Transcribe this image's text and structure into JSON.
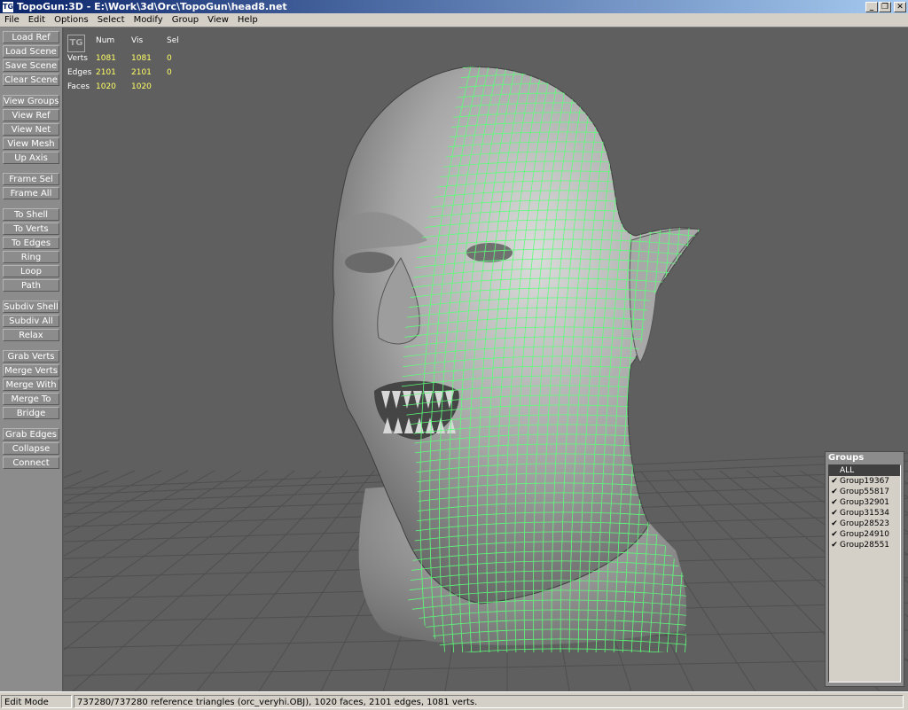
{
  "window": {
    "title": "TopoGun:3D - E:\\Work\\3d\\Orc\\TopoGun\\head8.net",
    "app_icon": "TG",
    "controls": {
      "minimize": "_",
      "restore": "❐",
      "close": "✕"
    }
  },
  "menu": [
    "File",
    "Edit",
    "Options",
    "Select",
    "Modify",
    "Group",
    "View",
    "Help"
  ],
  "toolbar": {
    "buttons": [
      "Load Ref",
      "Load Scene",
      "Save Scene",
      "Clear Scene",
      "View Groups",
      "View Ref",
      "View Net",
      "View Mesh",
      "Up Axis",
      "Frame Sel",
      "Frame All",
      "To Shell",
      "To Verts",
      "To Edges",
      "Ring",
      "Loop",
      "Path",
      "Subdiv Shell",
      "Subdiv All",
      "Relax",
      "Grab Verts",
      "Merge Verts",
      "Merge With",
      "Merge To",
      "Bridge",
      "Grab Edges",
      "Collapse",
      "Connect"
    ]
  },
  "stats": {
    "headers": {
      "num": "Num",
      "vis": "Vis",
      "sel": "Sel"
    },
    "rows": [
      {
        "label": "Verts",
        "num": "1081",
        "vis": "1081",
        "sel": "0"
      },
      {
        "label": "Edges",
        "num": "2101",
        "vis": "2101",
        "sel": "0"
      },
      {
        "label": "Faces",
        "num": "1020",
        "vis": "1020",
        "sel": ""
      }
    ]
  },
  "groups": {
    "title": "Groups",
    "items": [
      {
        "label": "ALL",
        "checked": false
      },
      {
        "label": "Group19367",
        "checked": true
      },
      {
        "label": "Group55817",
        "checked": true
      },
      {
        "label": "Group32901",
        "checked": true
      },
      {
        "label": "Group31534",
        "checked": true
      },
      {
        "label": "Group28523",
        "checked": true
      },
      {
        "label": "Group24910",
        "checked": true
      },
      {
        "label": "Group28551",
        "checked": true
      }
    ]
  },
  "status": {
    "mode": "Edit Mode",
    "message": "737280/737280 reference triangles (orc_veryhi.OBJ), 1020 faces, 2101 edges, 1081 verts."
  },
  "colors": {
    "mesh_wire": "#5dff7a",
    "stat_value": "#ffff66",
    "viewport_bg": "#5f5f5f"
  }
}
